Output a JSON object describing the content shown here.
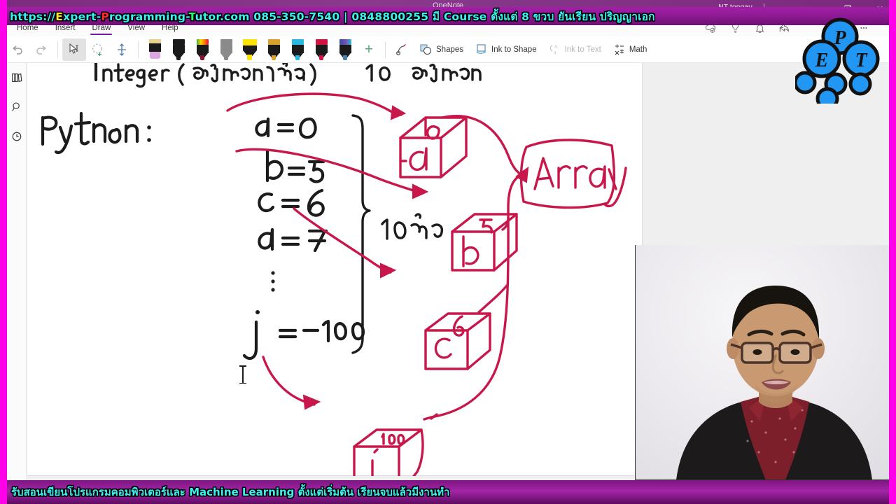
{
  "window": {
    "app_name": "OneNote",
    "account_name": "NT tongau",
    "minimize_label": "–",
    "maximize_label": "❐",
    "close_label": "✕"
  },
  "promo": {
    "top_parts": [
      {
        "text": "https://",
        "color": "cyan"
      },
      {
        "text": "E",
        "color": "yellow"
      },
      {
        "text": "xpert-",
        "color": "cyan"
      },
      {
        "text": "P",
        "color": "red"
      },
      {
        "text": "rogramming-",
        "color": "cyan"
      },
      {
        "text": "T",
        "color": "green"
      },
      {
        "text": "utor.com 085-350-7540 | 0848800255 มี Course ตั้งแต่ 8 ขวบ ยันเรียน ปริญญาเอก",
        "color": "cyan"
      }
    ],
    "bottom_text": "รับสอนเขียนโปรแกรมคอมพิวเตอร์และ Machine Learning ตั้งแต่เริ่มต้น เรียนจบแล้วมีงานทำ",
    "banner_bg": "#8d1a93",
    "banner_text_color": "#3df0f0",
    "frame_color": "#ff00e8"
  },
  "ribbon": {
    "tabs": [
      {
        "label": "Home",
        "active": false
      },
      {
        "label": "Insert",
        "active": false
      },
      {
        "label": "Draw",
        "active": true
      },
      {
        "label": "View",
        "active": false
      },
      {
        "label": "Help",
        "active": false
      }
    ],
    "active_tab_underline": "#7719aa",
    "buttons": [
      {
        "name": "undo-button",
        "label": "Undo"
      },
      {
        "name": "redo-button",
        "label": "Redo"
      },
      {
        "name": "select-tool-button",
        "label": "Select"
      },
      {
        "name": "lasso-select-button",
        "label": "Lasso Select"
      },
      {
        "name": "insert-space-button",
        "label": "Insert Space"
      }
    ],
    "pens": [
      {
        "name": "eraser-tool",
        "label": "Eraser",
        "cap": "#e8d08f",
        "nib": "#d9a6e0"
      },
      {
        "name": "pen-black",
        "label": "Pen black",
        "cap": "#1a1a1a",
        "nib": "#1a1a1a"
      },
      {
        "name": "pen-rainbow",
        "label": "Pen rainbow",
        "cap": "rainbow",
        "nib": "#8a1030"
      },
      {
        "name": "pencil-gray",
        "label": "Pencil",
        "cap": "#8a8a8a",
        "nib": "#8a8a8a"
      },
      {
        "name": "highlighter-yellow",
        "label": "Highlighter yellow",
        "cap": "#ffe400",
        "nib": "#ffe400"
      },
      {
        "name": "pen-gold",
        "label": "Pen gold",
        "cap": "#d8a32a",
        "nib": "#d8a32a"
      },
      {
        "name": "pen-cyan",
        "label": "Pen cyan",
        "cap": "#2bb8e0",
        "nib": "#2bb8e0"
      },
      {
        "name": "pen-red",
        "label": "Pen red",
        "cap": "#d1143f",
        "nib": "#d1143f"
      },
      {
        "name": "pen-galaxy",
        "label": "Pen galaxy",
        "cap": "galaxy",
        "nib": "#4b7fa8"
      }
    ],
    "add_pen_label": "+",
    "tools": [
      {
        "name": "ink-replay-button",
        "label": "",
        "icon": "ink-replay-icon",
        "disabled": false
      },
      {
        "name": "shapes-button",
        "label": "Shapes",
        "icon": "shapes-icon",
        "disabled": false
      },
      {
        "name": "ink-to-shape-button",
        "label": "Ink to Shape",
        "icon": "ink-to-shape-icon",
        "disabled": false
      },
      {
        "name": "ink-to-text-button",
        "label": "Ink to Text",
        "icon": "ink-to-text-icon",
        "disabled": true
      },
      {
        "name": "math-button",
        "label": "Math",
        "icon": "math-icon",
        "disabled": false
      }
    ]
  },
  "titlebar_icons": [
    {
      "name": "sync-status-icon",
      "label": "Sync status"
    },
    {
      "name": "tell-me-icon",
      "label": "Tell me what you want to do"
    },
    {
      "name": "notifications-icon",
      "label": "Notifications"
    },
    {
      "name": "share-icon",
      "label": "Share"
    },
    {
      "name": "expand-icon",
      "label": "Full screen"
    },
    {
      "name": "more-options-icon",
      "label": "More options"
    }
  ],
  "sidebar": {
    "items": [
      {
        "name": "sidebar-item-notebooks",
        "icon": "notebooks-icon",
        "label": "Notebooks"
      },
      {
        "name": "sidebar-item-search",
        "icon": "search-icon",
        "label": "Search"
      },
      {
        "name": "sidebar-item-recent",
        "icon": "clock-icon",
        "label": "Recent Notes"
      }
    ]
  },
  "notes": {
    "ink_color_black": "#1a1a1a",
    "ink_color_red": "#c8184b",
    "heading": "Integer (จำนวนเต็ม)  10  จำนวน",
    "language_label": "Python :",
    "variables": [
      {
        "name": "a",
        "value": "0",
        "line": "a = 0"
      },
      {
        "name": "b",
        "value": "5",
        "line": "b = 5"
      },
      {
        "name": "c",
        "value": "6",
        "line": "c = 6"
      },
      {
        "name": "d",
        "value": "7",
        "line": "d = 7"
      },
      {
        "name": "ellipsis",
        "value": "",
        "line": "⋮"
      },
      {
        "name": "j",
        "value": "-100",
        "line": "j = -100"
      }
    ],
    "brace_label": "10 ตัว",
    "boxes": [
      {
        "name": "box-a",
        "label": "a",
        "top_value": "0"
      },
      {
        "name": "box-b",
        "label": "b",
        "top_value": "5"
      },
      {
        "name": "box-c",
        "label": "c",
        "top_value": "6"
      },
      {
        "name": "box-j",
        "label": "j",
        "top_value": "100"
      }
    ],
    "array_label": "Array"
  },
  "webcam": {
    "present": true,
    "border_color": "#5e0b61",
    "background": "#eceaee"
  },
  "logo": {
    "nodes": [
      "P",
      "E",
      "T"
    ],
    "color": "#2196f3"
  }
}
